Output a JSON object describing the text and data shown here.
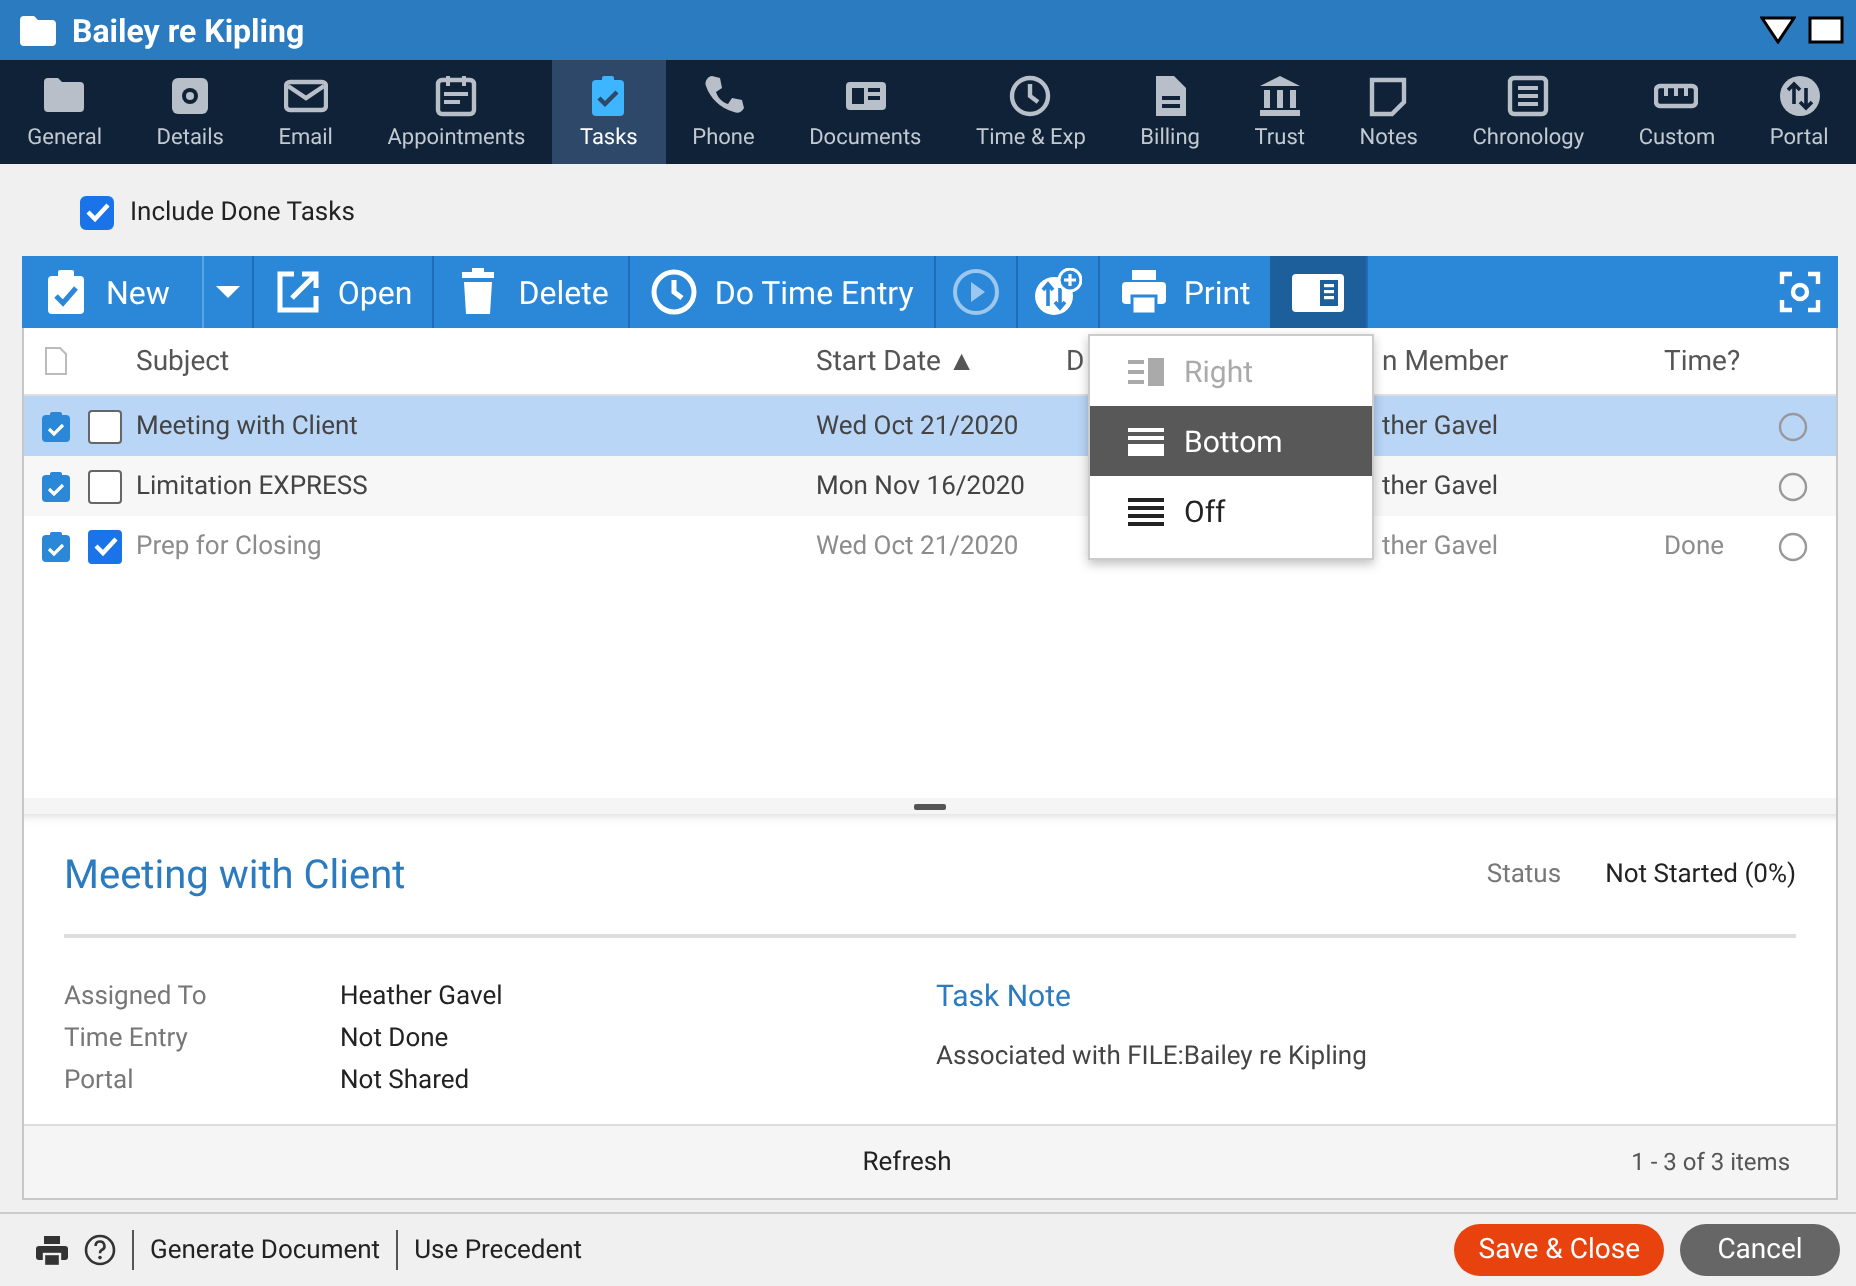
{
  "window": {
    "title": "Bailey re Kipling"
  },
  "nav_tabs": [
    {
      "label": "General",
      "selected": false
    },
    {
      "label": "Details",
      "selected": false
    },
    {
      "label": "Email",
      "selected": false
    },
    {
      "label": "Appointments",
      "selected": false
    },
    {
      "label": "Tasks",
      "selected": true
    },
    {
      "label": "Phone",
      "selected": false
    },
    {
      "label": "Documents",
      "selected": false
    },
    {
      "label": "Time & Exp",
      "selected": false
    },
    {
      "label": "Billing",
      "selected": false
    },
    {
      "label": "Trust",
      "selected": false
    },
    {
      "label": "Notes",
      "selected": false
    },
    {
      "label": "Chronology",
      "selected": false
    },
    {
      "label": "Custom",
      "selected": false
    },
    {
      "label": "Portal",
      "selected": false
    }
  ],
  "include_done": {
    "label": "Include Done Tasks",
    "checked": true
  },
  "toolbar": {
    "buttons": [
      {
        "kind": "new",
        "label": "New",
        "pressed": false
      },
      {
        "kind": "caret",
        "pressed": false
      },
      {
        "kind": "open",
        "label": "Open",
        "pressed": false
      },
      {
        "kind": "delete",
        "label": "Delete",
        "pressed": false
      },
      {
        "kind": "time",
        "label": "Do Time Entry",
        "pressed": false
      },
      {
        "kind": "play",
        "pressed": false
      },
      {
        "kind": "sort",
        "pressed": false
      },
      {
        "kind": "print",
        "label": "Print",
        "pressed": false
      },
      {
        "kind": "layout",
        "pressed": true
      }
    ]
  },
  "layout_menu": {
    "items": [
      {
        "kind": "right",
        "label": "Right",
        "disabled": true,
        "selected": false
      },
      {
        "kind": "bottom",
        "label": "Bottom",
        "disabled": false,
        "selected": true
      },
      {
        "kind": "off",
        "label": "Off",
        "disabled": false,
        "selected": false
      }
    ]
  },
  "table": {
    "columns": [
      "Subject",
      "Start Date ▲",
      "D",
      "n Member",
      "Time?"
    ],
    "rows": [
      {
        "selected": true,
        "done": false,
        "subject": "Meeting with Client",
        "start_date": "Wed Oct 21/2020",
        "member": "ther Gavel"
      },
      {
        "selected": false,
        "done": false,
        "subject": "Limitation EXPRESS",
        "start_date": "Mon Nov 16/2020",
        "member": "ther Gavel"
      },
      {
        "selected": false,
        "done": true,
        "subject": "Prep for Closing",
        "start_date": "Wed Oct 21/2020",
        "member": "ther Gavel",
        "time": "Done"
      }
    ]
  },
  "detail": {
    "title": "Meeting with Client",
    "status_label": "Status",
    "status_value": "Not Started (0%)",
    "fields": [
      {
        "label": "Assigned To",
        "value": "Heather Gavel"
      },
      {
        "label": "Time Entry",
        "value": "Not Done"
      },
      {
        "label": "Portal",
        "value": "Not Shared"
      }
    ],
    "note_heading": "Task Note",
    "note_text": "Associated with FILE:Bailey re Kipling"
  },
  "grid_footer": {
    "refresh": "Refresh",
    "count": "1 - 3 of 3 items"
  },
  "bottom_bar": {
    "links": [
      "Generate Document",
      "Use Precedent"
    ],
    "buttons": [
      {
        "kind": "primary",
        "label": "Save & Close"
      },
      {
        "kind": "secondary",
        "label": "Cancel"
      }
    ]
  }
}
